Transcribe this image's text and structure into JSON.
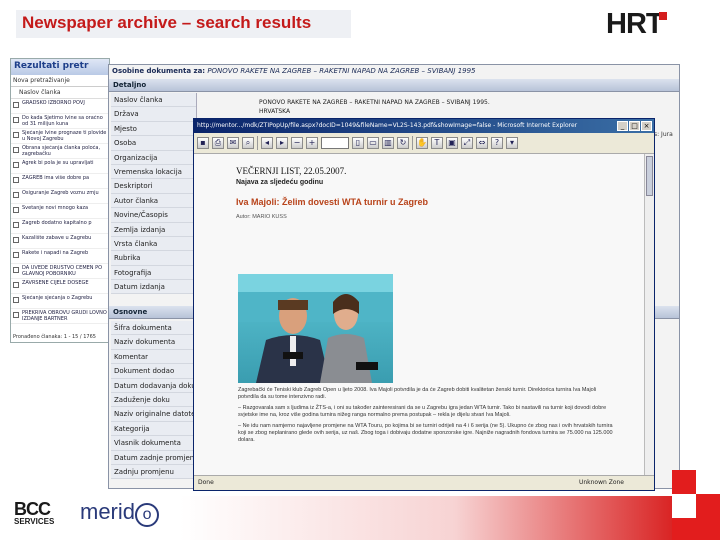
{
  "slide": {
    "title": "Newspaper archive – search results",
    "logo_hrt": "HRT"
  },
  "results": {
    "header": "Rezultati pretr",
    "sub": "Nova pretraživanje",
    "column": "Naslov članka",
    "items": [
      "GRADSKO IZBORNO POVJ",
      "Do kada Sjetimo Ivine sa oraćno od 31 milijun kuna",
      "Sjećanje Ivine prognaze ti plovide u Novoj Zagrebu",
      "Obrana sjećanja članka poloća, zagrebačku",
      "Agrek bi pola je su upravljati",
      "ZAGREB ima više dobre pa",
      "Osiguranje Zagreb voznu zmju",
      "Svetanje novi mnogo kaza",
      "Zagreb dodatno kapitalno p",
      "Kazalište zabave u Zagrebu",
      "Rakete i napadi na Zagreb",
      "DA UVEDE DRUŠTVO CEMEN PO GLAVNOJ POBORNIKU",
      "ZAVRŠENE CIJELE DOSEGE",
      "Sjećanje sjećanja o Zagrebu",
      "PREKRIVA OBROVU GRUDI LOVNO IZDANJE BARTNER"
    ],
    "footer": "Pronađeno članaka: 1 - 15 / 1765"
  },
  "metadata": {
    "document_label": "Osobine dokumenta za:",
    "document_name": "PONOVO RAKETE NA ZAGREB – RAKETNI NAPAD NA ZAGREB – SVIBANJ 1995",
    "section_details": "Detaljno",
    "detail_labels": [
      "Naslov članka",
      "Država",
      "Mjesto",
      "Osoba",
      "Organizacija",
      "Vremenska lokacija",
      "Deskriptori",
      "Autor članka",
      "Novine/Časopis",
      "Zemlja izdanja",
      "Vrsta članka",
      "Rubrika",
      "Fotografija",
      "Datum izdanja"
    ],
    "section_basic": "Osnovne",
    "basic_labels": [
      "Šifra dokumenta",
      "Naziv dokumenta",
      "Komentar",
      "Dokument dodao",
      "Datum dodavanja doku",
      "Zaduženje doku",
      "Naziv originalne datoteke",
      "Kategorija",
      "Vlasnik dokumenta",
      "Datum zadnje promjene",
      "Zadnju promjenu"
    ],
    "value_title": "PONOVO RAKETE NA ZAGREB – RAKETNI NAPAD NA ZAGREB – SVIBANJ 1995.",
    "value_country": "HRVATSKA",
    "right_note": "s: Jura"
  },
  "viewer": {
    "window_title": "http://mentor.../mdk/ZTIPopUp/file.aspx?docID=1049&fileName=VL2S-143.pdf&showImage=false - Microsoft Internet Explorer",
    "zoom_value": "",
    "status_left": "Done",
    "status_zone": "Unknown Zone",
    "article": {
      "source": "VEČERNJI LIST, 22.05.2007.",
      "section": "Najava za sljedeću godinu",
      "headline": "Iva Majoli: Želim dovesti WTA turnir u Zagreb",
      "author": "Autor: MARIO KUSS",
      "paragraphs": [
        "Zagrebački će Teniski klub Zagreb Open u ljeto 2008. Iva Majoli potvrdila je da će Zagreb dobiti kvalitetan ženski turnir. Direktorica turnira Iva Majoli potvrdila da su tome intenzivno radi.",
        "– Razgovarala sam s ljudima iz ŽTS-a, i oni su također zainteresirani da se u Zagrebu igra jedan WTA turnir. Tako bi nastavili na turnir koji dovodi dobre svjetske ime na, kroz više godina turnira nižeg ranga normalno prema postupak – rekla je dijelu stvari Iva Majoli.",
        "– Ne idu nam namjerno najavljene promjene na WTA Touru, po kojima bi se turniri odrijeli na 4 i 6 serija (ne 5). Ukupno će zbog nas i ovih hrvatskih turnira koji se zbog neplanirano glede ovih serija, uz naš. Zbog toga i dobivaju dodatne sponzorske igre. Najniže nagradnih fondova turnira se 75.000 na 125.000 dolara."
      ]
    }
  },
  "footer": {
    "bcc": "BCC",
    "bcc_sub": "SERVICES",
    "meridio_left": "merid",
    "meridio_o": "o"
  },
  "colors": {
    "accent_red": "#d41e1e",
    "window_blue": "#0a246a",
    "headline_brown": "#b8431a"
  }
}
